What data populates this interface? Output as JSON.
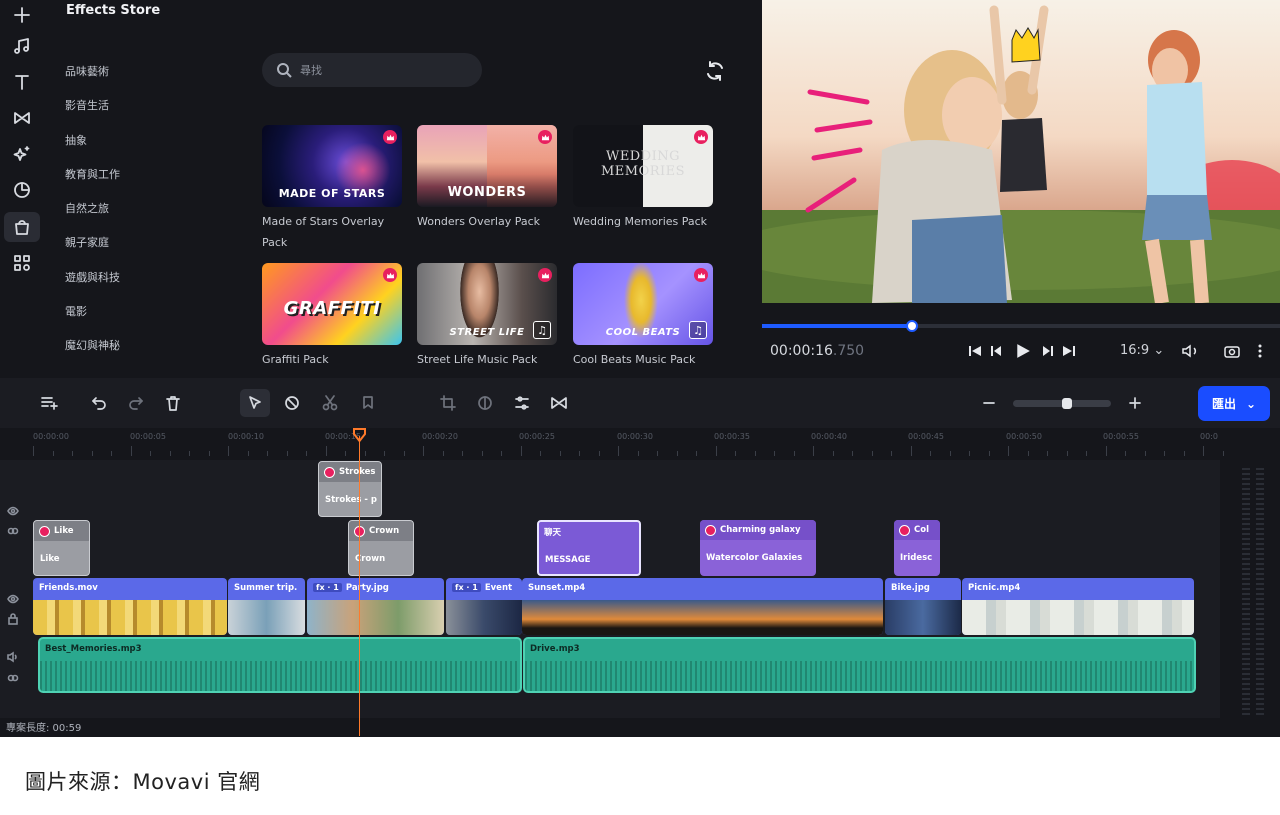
{
  "sidebar": {
    "tools": [
      "add-icon",
      "music-icon",
      "text-icon",
      "transition-icon",
      "sparkle-icon",
      "sticker-icon",
      "store-icon",
      "apps-icon"
    ]
  },
  "store": {
    "title": "Effects Store",
    "categories": [
      "品味藝術",
      "影音生活",
      "抽象",
      "教育與工作",
      "自然之旅",
      "親子家庭",
      "遊戲與科技",
      "電影",
      "魔幻與神秘"
    ],
    "search_placeholder": "尋找",
    "cards": [
      {
        "label": "Made of Stars Overlay Pack",
        "caption": "MADE OF STARS"
      },
      {
        "label": "Wonders Overlay Pack",
        "caption": "WONDERS"
      },
      {
        "label": "Wedding Memories Pack",
        "caption": "WEDDING MEMORIES"
      },
      {
        "label": "Graffiti Pack",
        "caption": "GRAFFITI"
      },
      {
        "label": "Street Life Music Pack",
        "caption": "STREET LIFE"
      },
      {
        "label": "Cool Beats Music Pack",
        "caption": "COOL BEATS"
      }
    ]
  },
  "player": {
    "time_main": "00:00:16",
    "time_ms": ".750",
    "progress": 0.29,
    "aspect": "16:9"
  },
  "timeline": {
    "export_label": "匯出",
    "zoom_level": 0.55,
    "ruler": [
      "00:00:00",
      "00:00:05",
      "00:00:10",
      "00:00:15",
      "00:00:20",
      "00:00:25",
      "00:00:30",
      "00:00:35",
      "00:00:40",
      "00:00:45",
      "00:00:50",
      "00:00:55",
      "00:0"
    ],
    "overlay_clips": [
      {
        "title": "Strokes",
        "sub": "Strokes - p"
      },
      {
        "title": "Like",
        "sub": "Like"
      },
      {
        "title": "Crown",
        "sub": "Crown"
      },
      {
        "title": "聊天",
        "sub": "MESSAGE"
      },
      {
        "title": "Charming galaxy",
        "sub": "Watercolor Galaxies"
      },
      {
        "title": "Col",
        "sub": "Iridesc"
      }
    ],
    "video_clips": [
      "Friends.mov",
      "Summer trip.",
      "Party.jpg",
      "Event",
      "Sunset.mp4",
      "Bike.jpg",
      "Picnic.mp4"
    ],
    "fx_badge": "fx · 1",
    "audio_clips": [
      "Best_Memories.mp3",
      "Drive.mp3"
    ],
    "duration": "專案長度: 00:59"
  },
  "caption": "圖片來源：Movavi 官網",
  "colors": {
    "accent": "#1a4dff",
    "premium": "#e8205f",
    "video": "#5b69e8",
    "audio": "#2aa88e",
    "playhead": "#ff7a2a"
  }
}
